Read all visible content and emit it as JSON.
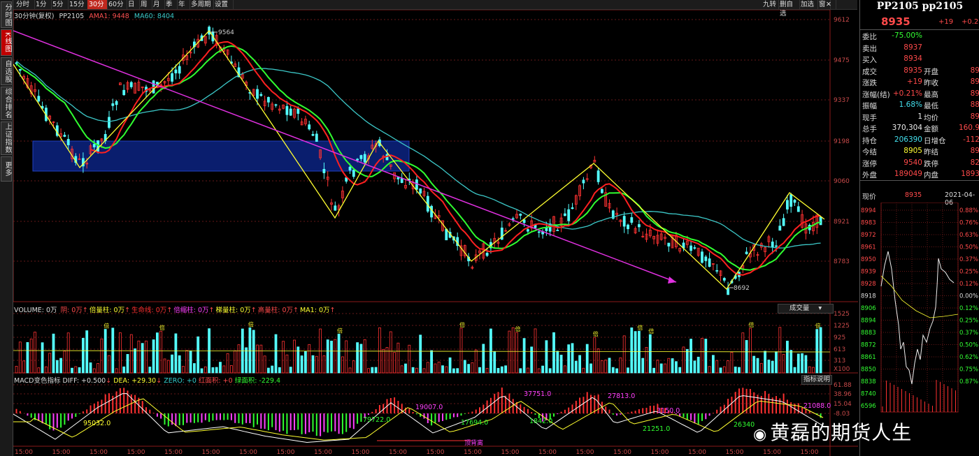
{
  "colors": {
    "up": "#ff3232",
    "down": "#54ffff",
    "ma1": "#ff2020",
    "ma2": "#30ff30",
    "ma3": "#3cc7c7",
    "zigzag": "#ffff30",
    "trend": "#e030e0",
    "box": "#0a1e6e",
    "box_border": "#2040c0",
    "grid": "#661818"
  },
  "left_tabs": [
    {
      "label": "分时图",
      "active": false
    },
    {
      "label": "K线图",
      "active": true
    },
    {
      "label": "自选股",
      "active": false
    },
    {
      "label": "综合排名",
      "active": false
    },
    {
      "label": "上证指数",
      "active": false
    },
    {
      "label": "更多",
      "active": false
    }
  ],
  "toolbar": {
    "periods": [
      "分时",
      "1分",
      "5分",
      "15分",
      "30分",
      "60分",
      "日",
      "周",
      "月",
      "季",
      "年",
      "多周期",
      "设置"
    ],
    "active_period": "30分",
    "right_buttons": [
      "九转",
      "删自选",
      "加选",
      "窗"
    ]
  },
  "main": {
    "period_label": "30分钟(复权)",
    "symbol": "PP2105",
    "ma1_label": "AMA1: 9448",
    "ma2_label": "MA60: 8404",
    "y_ticks": [
      "9612",
      "9475",
      "9337",
      "9198",
      "9060",
      "8921",
      "8783"
    ],
    "high_label": "9564",
    "low_label": "8692"
  },
  "volume": {
    "title": "VOLUME: 0万",
    "items": [
      {
        "text": "阴: 0万",
        "color": "#ff4a4a"
      },
      {
        "text": "倍量柱: 0万",
        "color": "#ffff30"
      },
      {
        "text": "生命线: 0万",
        "color": "#ff3030"
      },
      {
        "text": "倍缩柱: 0万",
        "color": "#ff40ff"
      },
      {
        "text": "梯量柱: 0万",
        "color": "#ffff30"
      },
      {
        "text": "高量柱: 0万",
        "color": "#ff4a4a"
      },
      {
        "text": "MA1: 0万",
        "color": "#ffff30"
      }
    ],
    "dropdown": "成交量",
    "y_ticks": [
      "1525",
      "1225",
      "925",
      "613",
      "313",
      "X100"
    ],
    "marker": "倍"
  },
  "macd": {
    "title": "MACD变色指标",
    "diff": "DIFF: +0.500",
    "dea": "DEA: +29.30",
    "zero": "ZERO: +0",
    "red_area": "红面积: +0",
    "green_area": "绿面积: -229.4",
    "button": "指标说明",
    "y_ticks": [
      "61.88",
      "38.96",
      "15.04",
      "-8.03"
    ],
    "area_labels": [
      "95032.0",
      "79722.0",
      "19007.0",
      "17694.0",
      "37751.0",
      "1842.0",
      "27813.0",
      "3150.0",
      "21251.0",
      "26340",
      "21088.0"
    ],
    "bottom_note": "顶背离"
  },
  "x_labels": [
    "15:00",
    "15:00",
    "15:00",
    "15:00",
    "15:00",
    "15:00",
    "15:00",
    "15:00",
    "15:00",
    "15:00",
    "15:00",
    "15:00",
    "15:00",
    "15:00",
    "15:00",
    "15:00",
    "15:00",
    "15:00",
    "15:00",
    "15:00",
    "15:00",
    "15:00"
  ],
  "quote": {
    "title": "PP2105 pp2105",
    "price": "8935",
    "change": "+19",
    "change_pct": "+0.21",
    "rows": [
      {
        "l": "委比",
        "v": "-75.00%",
        "vc": "green",
        "l2": "",
        "v2": ""
      },
      {
        "l": "卖出",
        "v": "8937",
        "vc": "red",
        "l2": "",
        "v2": ""
      },
      {
        "l": "买入",
        "v": "8934",
        "vc": "red",
        "l2": "",
        "v2": ""
      },
      {
        "l": "成交",
        "v": "8935",
        "vc": "red",
        "l2": "开盘",
        "v2": "89"
      },
      {
        "l": "涨跌",
        "v": "+19",
        "vc": "red",
        "l2": "昨收",
        "v2": "89"
      },
      {
        "l": "涨幅(结)",
        "v": "+0.21%",
        "vc": "red",
        "l2": "最高",
        "v2": "89"
      },
      {
        "l": "振幅",
        "v": "1.68%",
        "vc": "cyan",
        "l2": "最低",
        "v2": "88"
      },
      {
        "l": "现手",
        "v": "1",
        "vc": "white",
        "l2": "均价",
        "v2": "89"
      },
      {
        "l": "总手",
        "v": "370,304",
        "vc": "white",
        "l2": "金额",
        "v2": "160.9"
      },
      {
        "l": "持仓",
        "v": "206390",
        "vc": "cyan",
        "l2": "日增仓",
        "v2": "-112"
      },
      {
        "l": "今结",
        "v": "8905",
        "vc": "yel",
        "l2": "昨结",
        "v2": "89"
      },
      {
        "l": "涨停",
        "v": "9540",
        "vc": "red",
        "l2": "跌停",
        "v2": "82"
      },
      {
        "l": "外盘",
        "v": "189049",
        "vc": "red",
        "l2": "内盘",
        "v2": "1893"
      }
    ],
    "mini": {
      "label": "现价",
      "price": "8935",
      "date": "2021-04-06",
      "y_left": [
        "8994",
        "8983",
        "8972",
        "8961",
        "8950",
        "8939",
        "8928",
        "8918",
        "8906",
        "8894",
        "8883",
        "8872",
        "8861",
        "8850",
        "8838",
        "8740",
        "6596"
      ],
      "y_right": [
        "0.88%",
        "0.76%",
        "0.63%",
        "0.50%",
        "0.37%",
        "0.25%",
        "0.12%",
        "0.00%",
        "0.12%",
        "0.25%",
        "0.37%",
        "0.50%",
        "0.62%",
        "0.75%",
        "0.87%"
      ]
    }
  },
  "watermark": "黄磊的期货人生"
}
